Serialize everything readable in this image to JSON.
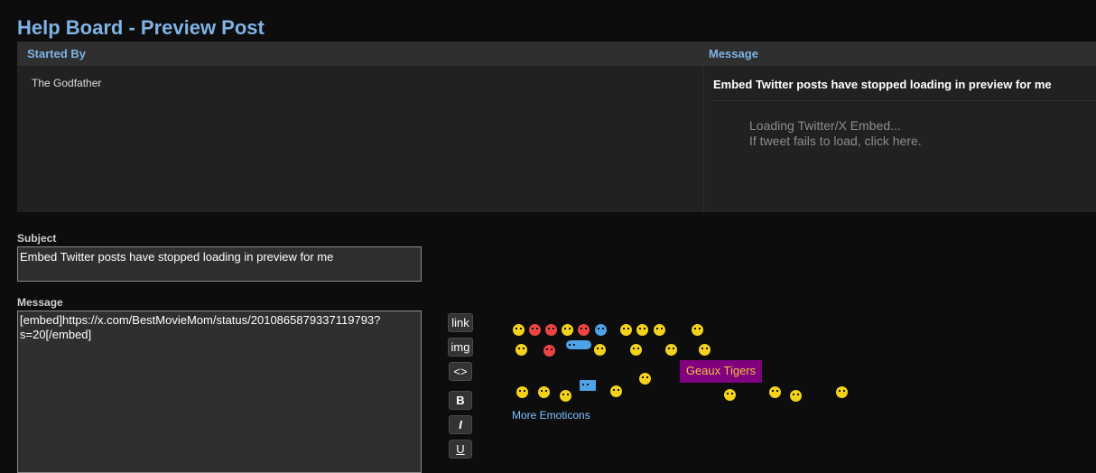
{
  "page": {
    "title": "Help Board - Preview Post"
  },
  "table": {
    "col_started_by": "Started By",
    "col_message": "Message",
    "author": "The Godfather",
    "post_subject": "Embed Twitter posts have stopped loading in preview for me",
    "embed_line1": "Loading Twitter/X Embed...",
    "embed_line2": "If tweet fails to load, click here."
  },
  "form": {
    "subject_label": "Subject",
    "subject_value": "Embed Twitter posts have stopped loading in preview for me",
    "message_label": "Message",
    "message_value": "[embed]https://x.com/BestMovieMom/status/2010865879337119793?s=20[/embed]"
  },
  "toolbar": {
    "link": "link",
    "img": "img",
    "code": "<>",
    "bold": "B",
    "italic": "I",
    "underline": "U"
  },
  "emoticons": {
    "more_label": "More Emoticons",
    "tooltip": "Geaux Tigers"
  }
}
